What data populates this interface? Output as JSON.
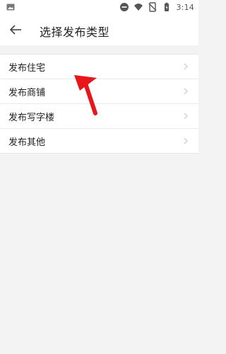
{
  "status_bar": {
    "time": "3:14",
    "icons": [
      "gallery-notification-icon",
      "do-not-disturb-icon",
      "wifi-icon",
      "no-sim-icon",
      "battery-icon"
    ]
  },
  "app_bar": {
    "title": "选择发布类型",
    "back_icon": "back-arrow-icon"
  },
  "list": {
    "items": [
      {
        "label": "发布住宅"
      },
      {
        "label": "发布商铺"
      },
      {
        "label": "发布写字楼"
      },
      {
        "label": "发布其他"
      }
    ]
  },
  "colors": {
    "background": "#f3f3f3",
    "surface": "#ffffff",
    "text": "#222222",
    "chevron": "#c8c8c8",
    "annotation_arrow": "#e8151b"
  }
}
